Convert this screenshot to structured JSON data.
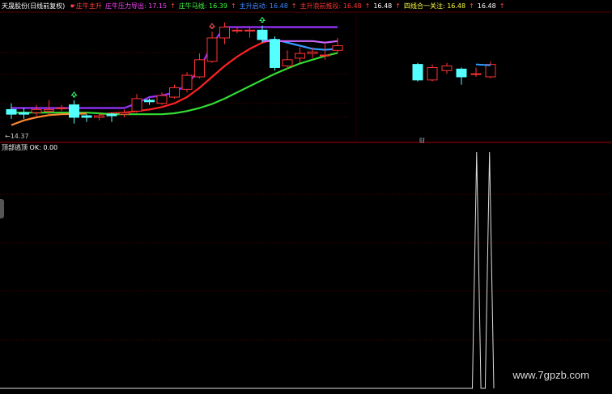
{
  "header": {
    "title": "天晟股份(日线前复权)",
    "items": [
      {
        "text": "☛庄牛主升",
        "color": "#ff4444"
      },
      {
        "text": "庄牛压力导出: 17.15",
        "color": "#ff44ff"
      },
      {
        "text": "↑",
        "color": "#ff4444"
      },
      {
        "text": "庄牛马线: 16.39",
        "color": "#44ff44"
      },
      {
        "text": "↑",
        "color": "#ff4444"
      },
      {
        "text": "主升启动: 16.48",
        "color": "#4488ff"
      },
      {
        "text": "↑",
        "color": "#ff4444"
      },
      {
        "text": "主升浪前推段: 16.48",
        "color": "#ff3333"
      },
      {
        "text": "↑",
        "color": "#ff4444"
      },
      {
        "text": "16.48",
        "color": "#ffffff"
      },
      {
        "text": "↑",
        "color": "#ff4444"
      },
      {
        "text": "四线合一关注: 16.48",
        "color": "#ffff44"
      },
      {
        "text": "↑",
        "color": "#ff4444"
      },
      {
        "text": "16.48",
        "color": "#ffffff"
      },
      {
        "text": "↑",
        "color": "#ff4444"
      }
    ]
  },
  "low_label": "←14.37",
  "tip_label": "财",
  "subchart_label": "顶部逃顶 OK: 0.00",
  "watermark": "www.7gpzb.com",
  "chart_data": [
    {
      "type": "candlestick",
      "panel": "main",
      "ylim": [
        14.0,
        17.9
      ],
      "bars": [
        {
          "i": 0,
          "o": 14.9,
          "c": 14.75,
          "h": 15.1,
          "l": 14.6
        },
        {
          "i": 1,
          "o": 14.8,
          "c": 14.75,
          "h": 14.95,
          "l": 14.6
        },
        {
          "i": 2,
          "o": 14.8,
          "c": 14.9,
          "h": 15.05,
          "l": 14.7
        },
        {
          "i": 3,
          "o": 14.85,
          "c": 14.9,
          "h": 15.2,
          "l": 14.75
        },
        {
          "i": 4,
          "o": 14.95,
          "c": 14.95,
          "h": 15.05,
          "l": 14.85
        },
        {
          "i": 5,
          "o": 15.05,
          "c": 14.65,
          "h": 15.2,
          "l": 14.45
        },
        {
          "i": 6,
          "o": 14.7,
          "c": 14.65,
          "h": 14.75,
          "l": 14.5
        },
        {
          "i": 7,
          "o": 14.65,
          "c": 14.7,
          "h": 14.8,
          "l": 14.55
        },
        {
          "i": 8,
          "o": 14.75,
          "c": 14.7,
          "h": 14.8,
          "l": 14.5
        },
        {
          "i": 9,
          "o": 14.75,
          "c": 14.8,
          "h": 14.9,
          "l": 14.65
        },
        {
          "i": 10,
          "o": 14.85,
          "c": 15.25,
          "h": 15.4,
          "l": 14.8
        },
        {
          "i": 11,
          "o": 15.2,
          "c": 15.15,
          "h": 15.25,
          "l": 15.05
        },
        {
          "i": 12,
          "o": 15.1,
          "c": 15.35,
          "h": 15.45,
          "l": 15.05
        },
        {
          "i": 13,
          "o": 15.3,
          "c": 15.6,
          "h": 15.7,
          "l": 15.25
        },
        {
          "i": 14,
          "o": 15.55,
          "c": 16.0,
          "h": 16.1,
          "l": 15.45
        },
        {
          "i": 15,
          "o": 15.95,
          "c": 16.5,
          "h": 16.7,
          "l": 15.9
        },
        {
          "i": 16,
          "o": 16.45,
          "c": 17.2,
          "h": 17.4,
          "l": 16.4
        },
        {
          "i": 17,
          "o": 17.2,
          "c": 17.55,
          "h": 17.7,
          "l": 17.0
        },
        {
          "i": 18,
          "o": 17.45,
          "c": 17.45,
          "h": 17.55,
          "l": 17.35
        },
        {
          "i": 19,
          "o": 17.45,
          "c": 17.45,
          "h": 17.55,
          "l": 17.2
        },
        {
          "i": 20,
          "o": 17.45,
          "c": 17.15,
          "h": 17.6,
          "l": 17.05
        },
        {
          "i": 21,
          "o": 17.15,
          "c": 16.25,
          "h": 17.25,
          "l": 16.15
        },
        {
          "i": 22,
          "o": 16.3,
          "c": 16.5,
          "h": 16.8,
          "l": 16.2
        },
        {
          "i": 23,
          "o": 16.55,
          "c": 16.7,
          "h": 16.9,
          "l": 16.4
        },
        {
          "i": 24,
          "o": 16.7,
          "c": 16.75,
          "h": 16.9,
          "l": 16.55
        },
        {
          "i": 25,
          "o": 16.65,
          "c": 16.65,
          "h": 17.0,
          "l": 16.5
        },
        {
          "i": 26,
          "o": 16.8,
          "c": 16.95,
          "h": 17.2,
          "l": 16.7
        }
      ],
      "lines": [
        {
          "color": "#9933ff",
          "values": [
            14.95,
            14.95,
            14.95,
            14.95,
            14.95,
            14.95,
            14.95,
            14.95,
            14.95,
            14.95,
            15.1,
            15.3,
            15.35,
            15.45,
            15.7,
            16.2,
            17.0,
            17.55,
            17.55,
            17.55,
            17.55,
            17.55,
            17.55,
            17.55,
            17.55,
            17.55,
            17.55
          ]
        },
        {
          "color": "#ff2222",
          "values": [
            null,
            null,
            null,
            null,
            null,
            null,
            null,
            14.75,
            14.78,
            14.8,
            14.85,
            14.9,
            14.98,
            15.1,
            15.3,
            15.6,
            15.95,
            16.3,
            16.6,
            16.85,
            17.05,
            17.15,
            null,
            null,
            null,
            null,
            null
          ]
        },
        {
          "color": "#3399ff",
          "values": [
            null,
            null,
            null,
            null,
            null,
            null,
            null,
            null,
            null,
            null,
            null,
            null,
            null,
            null,
            null,
            null,
            null,
            null,
            null,
            null,
            17.1,
            17.15,
            17.05,
            16.95,
            16.85,
            16.82,
            16.85
          ]
        },
        {
          "color": "#33dd33",
          "values": [
            14.8,
            14.8,
            14.8,
            14.8,
            14.8,
            14.8,
            14.8,
            14.78,
            14.75,
            14.75,
            14.75,
            14.75,
            14.75,
            14.78,
            14.85,
            14.95,
            15.08,
            15.25,
            15.45,
            15.65,
            15.85,
            16.05,
            16.22,
            16.38,
            16.5,
            16.62,
            16.72
          ]
        },
        {
          "color": "#ff8833",
          "values": [
            14.4,
            14.55,
            14.65,
            14.72,
            14.75,
            14.76,
            14.77,
            null,
            null,
            null,
            null,
            null,
            null,
            null,
            null,
            null,
            null,
            null,
            null,
            null,
            null,
            null,
            null,
            null,
            null,
            null,
            null
          ]
        },
        {
          "color": "#cc66ff",
          "values": [
            null,
            null,
            null,
            null,
            null,
            null,
            null,
            null,
            null,
            null,
            null,
            null,
            null,
            null,
            null,
            null,
            null,
            null,
            null,
            null,
            17.1,
            17.1,
            17.1,
            17.1,
            17.1,
            17.05,
            17.1
          ]
        }
      ],
      "arrows": [
        {
          "i": 5,
          "color": "#33ff77"
        },
        {
          "i": 20,
          "color": "#33ff77"
        },
        {
          "i": 16,
          "color": "#ff5555"
        }
      ]
    },
    {
      "type": "candlestick",
      "panel": "main-right",
      "ylim": [
        14.0,
        17.9
      ],
      "bars": [
        {
          "i": 0,
          "o": 16.35,
          "c": 15.85,
          "h": 16.4,
          "l": 15.8
        },
        {
          "i": 1,
          "o": 15.85,
          "c": 16.25,
          "h": 16.35,
          "l": 15.8
        },
        {
          "i": 2,
          "o": 16.15,
          "c": 16.3,
          "h": 16.4,
          "l": 16.05
        },
        {
          "i": 3,
          "o": 16.2,
          "c": 15.95,
          "h": 16.25,
          "l": 15.7
        },
        {
          "i": 4,
          "o": 16.05,
          "c": 16.05,
          "h": 16.25,
          "l": 15.95
        },
        {
          "i": 5,
          "o": 15.95,
          "c": 16.35,
          "h": 16.45,
          "l": 15.9
        }
      ],
      "lines": [
        {
          "color": "#3399ff",
          "values": [
            null,
            null,
            null,
            null,
            16.35,
            16.32
          ]
        }
      ]
    },
    {
      "type": "line",
      "panel": "sub",
      "ylim": [
        0,
        100
      ],
      "values": [
        0,
        0,
        0,
        0,
        0,
        0,
        0,
        0,
        0,
        0,
        0,
        0,
        0,
        0,
        0,
        0,
        0,
        0,
        0,
        0,
        0,
        0,
        0,
        0,
        0,
        0,
        0,
        0,
        0,
        0,
        0,
        0,
        0,
        0,
        0,
        0,
        0,
        0,
        0,
        0,
        0,
        0,
        0,
        0,
        0,
        0,
        0,
        0,
        0,
        0,
        0,
        0,
        0,
        0,
        0,
        0,
        0,
        0,
        0,
        0,
        0,
        0,
        0,
        0,
        0,
        0,
        0,
        0,
        0,
        0,
        0,
        0,
        0,
        0,
        0,
        0,
        0,
        0,
        0,
        0,
        0,
        0,
        0,
        0,
        0,
        0,
        0,
        0,
        0,
        0,
        0,
        0,
        0,
        0,
        0,
        0,
        0,
        0,
        0,
        0,
        0,
        0,
        0,
        0,
        0,
        0,
        0,
        0,
        0,
        0,
        0,
        100,
        0,
        0,
        100,
        0
      ]
    }
  ]
}
